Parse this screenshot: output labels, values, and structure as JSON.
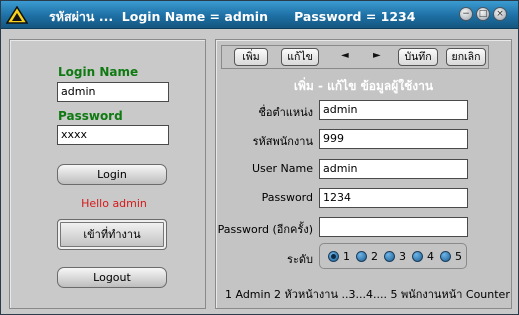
{
  "titlebar": {
    "text": "รหัสผ่าน ...  Login Name = admin      Password = 1234",
    "controls": [
      "minimize",
      "restore",
      "close"
    ]
  },
  "left": {
    "login_name_label": "Login Name",
    "login_name_value": "admin",
    "password_label": "Password",
    "password_value": "xxxx",
    "login_button": "Login",
    "hello_text": "Hello admin",
    "enter_work_button": "เข้าที่ทำงาน",
    "logout_button": "Logout"
  },
  "right": {
    "toolbar": {
      "add": "เพิ่ม",
      "edit": "แก้ไข",
      "prev": "◄",
      "next": "►",
      "save": "บันทึก",
      "cancel": "ยกเลิก"
    },
    "heading": "เพิ่ม - แก้ไข  ข้อมูลผู้ใช้งาน",
    "fields": {
      "position_label": "ชื่อตำแหน่ง",
      "position_value": "admin",
      "employee_code_label": "รหัสพนักงาน",
      "employee_code_value": "999",
      "username_label": "User Name",
      "username_value": "admin",
      "password_label": "Password",
      "password_value": "1234",
      "password_again_label": "Password (อีกครั้ง)",
      "password_again_value": ""
    },
    "level": {
      "label": "ระดับ",
      "options": [
        "1",
        "2",
        "3",
        "4",
        "5"
      ],
      "selected": "1"
    },
    "footer_note": "1  Admin    2 หัวหน้างาน ..3...4.... 5 พนักงานหน้า Counter"
  }
}
